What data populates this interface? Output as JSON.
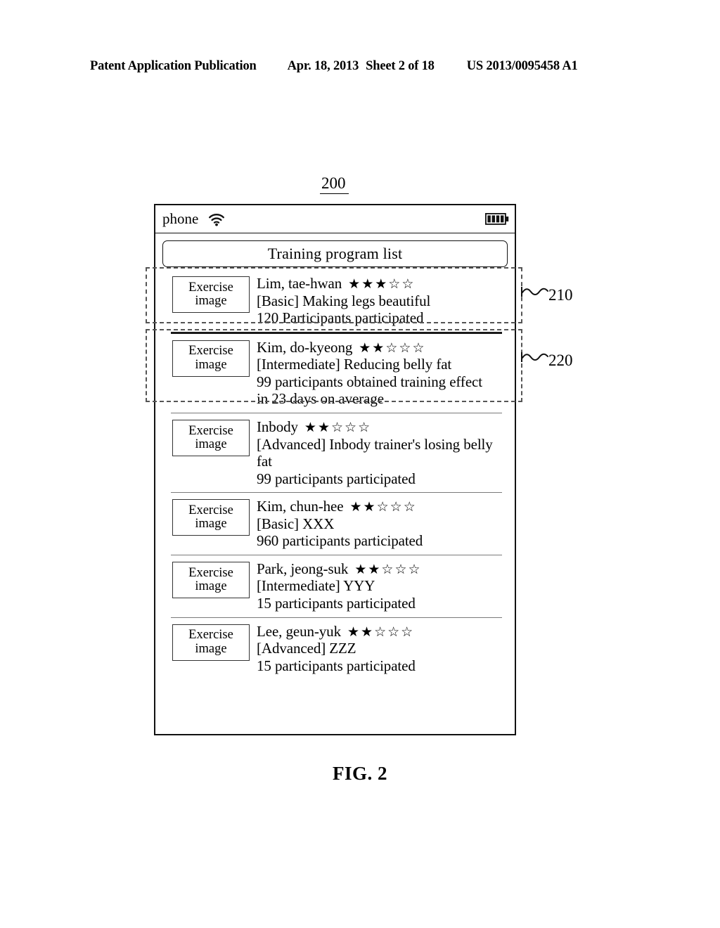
{
  "page_header": {
    "publication": "Patent Application Publication",
    "date": "Apr. 18, 2013",
    "sheet": "Sheet 2 of 18",
    "patent_number": "US 2013/0095458 A1"
  },
  "figure": {
    "device_ref": "200",
    "caption": "FIG. 2"
  },
  "status_bar": {
    "carrier": "phone",
    "wifi_icon": "wifi-icon",
    "battery_icon": "battery-icon",
    "battery_bars": 4
  },
  "title_bar": {
    "title": "Training program list"
  },
  "thumbnail": {
    "line1": "Exercise",
    "line2": "image"
  },
  "programs": [
    {
      "trainer": "Lim, tae-hwan",
      "rating_filled": 3,
      "rating_total": 5,
      "description": "[Basic] Making legs beautiful",
      "participants": "120 Participants participated",
      "extra": "",
      "callout": "210"
    },
    {
      "trainer": "Kim, do-kyeong",
      "rating_filled": 2,
      "rating_total": 5,
      "description": "[Intermediate] Reducing belly fat",
      "participants": "99 participants obtained training effect",
      "extra": "in 23 days on average",
      "callout": "220"
    },
    {
      "trainer": "Inbody",
      "rating_filled": 2,
      "rating_total": 5,
      "description": "[Advanced] Inbody trainer's losing belly fat",
      "participants": "99 participants participated",
      "extra": "",
      "callout": ""
    },
    {
      "trainer": "Kim, chun-hee",
      "rating_filled": 2,
      "rating_total": 5,
      "description": "[Basic] XXX",
      "participants": "960 participants participated",
      "extra": "",
      "callout": ""
    },
    {
      "trainer": "Park, jeong-suk",
      "rating_filled": 2,
      "rating_total": 5,
      "description": "[Intermediate] YYY",
      "participants": "15 participants participated",
      "extra": "",
      "callout": ""
    },
    {
      "trainer": "Lee, geun-yuk",
      "rating_filled": 2,
      "rating_total": 5,
      "description": "[Advanced] ZZZ",
      "participants": "15 participants participated",
      "extra": "",
      "callout": ""
    }
  ],
  "callouts": [
    {
      "number": "210",
      "target": "program-item-0"
    },
    {
      "number": "220",
      "target": "program-item-1"
    }
  ],
  "glyphs": {
    "star_filled": "★",
    "star_empty": "☆"
  },
  "colors": {
    "ink": "#000000",
    "paper": "#ffffff",
    "separator_thick": "#1a1a1a",
    "separator_thin": "#7a7a7a",
    "callout_dash": "#555555"
  }
}
